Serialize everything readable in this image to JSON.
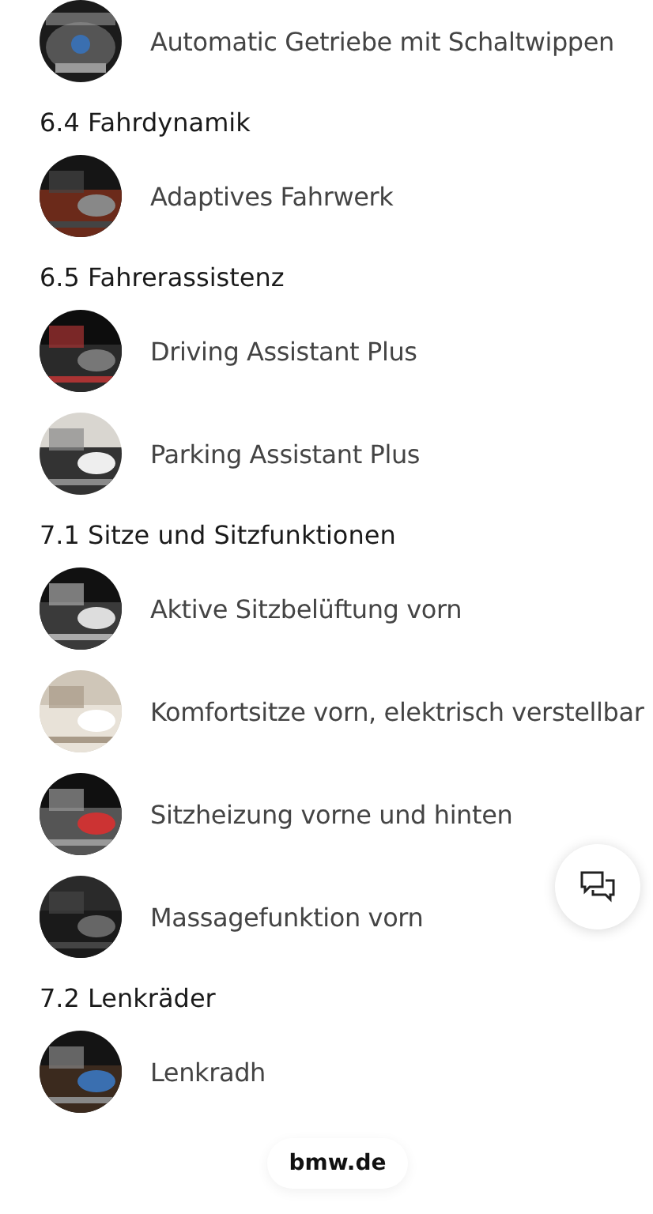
{
  "top_items": [
    {
      "label": "Automatic Getriebe mit Schaltwippen",
      "kind": "picture"
    }
  ],
  "sections": [
    {
      "title": "6.4 Fahrdynamik",
      "items": [
        {
          "label": "Adaptives Fahrwerk",
          "kind": "picture"
        }
      ]
    },
    {
      "title": "6.5 Fahrerassistenz",
      "items": [
        {
          "label": "Driving Assistant Plus",
          "kind": "picture"
        },
        {
          "label": "Parking Assistant Plus",
          "kind": "picture"
        }
      ]
    },
    {
      "title": "7.1 Sitze und Sitzfunktionen",
      "items": [
        {
          "label": "Aktive Sitzbelüftung vorn",
          "kind": "picture"
        },
        {
          "label": "Komfortsitze vorn, elektrisch verstellbar",
          "kind": "picture"
        },
        {
          "label": "Sitzheizung vorne und hinten",
          "kind": "picture"
        },
        {
          "label": "Massagefunktion vorn",
          "kind": "picture"
        }
      ]
    },
    {
      "title": "7.2 Lenkräder",
      "items": [
        {
          "label": "Lenkradh",
          "kind": "picture"
        }
      ]
    }
  ],
  "site_badge": "bmw.de"
}
